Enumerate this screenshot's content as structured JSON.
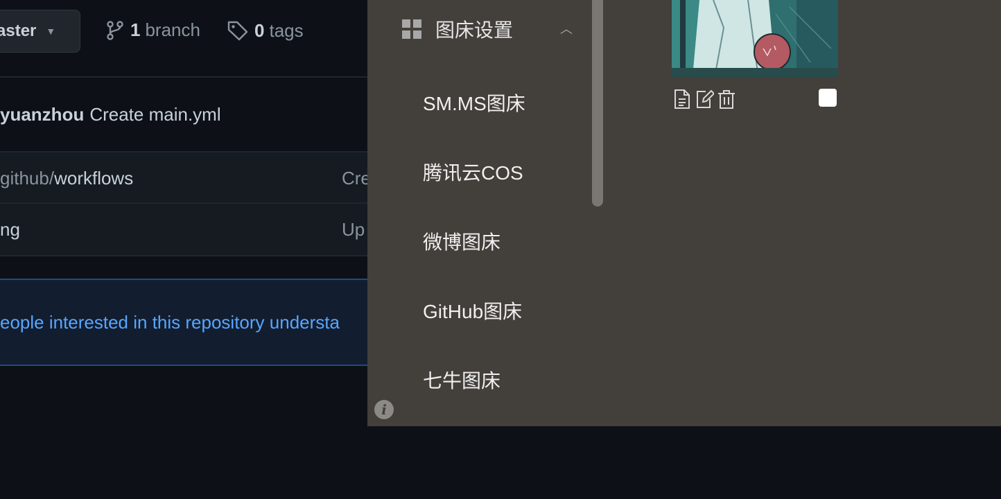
{
  "github": {
    "branch_button": {
      "label": "aster",
      "icon": "caret-down-icon"
    },
    "branches": {
      "count": "1",
      "label": "branch",
      "icon": "git-branch-icon"
    },
    "tags": {
      "count": "0",
      "label": "tags",
      "icon": "tag-icon"
    },
    "commit": {
      "author": "yuanzhou",
      "message": "Create main.yml"
    },
    "files": [
      {
        "prefix": "github/",
        "name": "workflows",
        "message": "Cre"
      },
      {
        "prefix": "",
        "name": "ng",
        "message": "Up"
      }
    ],
    "banner_text": "eople interested in this repository understa"
  },
  "picgo": {
    "menu_header": {
      "label": "图床设置",
      "icon": "grid-icon",
      "toggle_icon": "chevron-up-icon"
    },
    "menu_items": [
      "SM.MS图床",
      "腾讯云COS",
      "微博图床",
      "GitHub图床",
      "七牛图床"
    ],
    "image_actions": [
      "copy-link-icon",
      "edit-icon",
      "delete-icon"
    ],
    "info_icon": "info-icon"
  }
}
